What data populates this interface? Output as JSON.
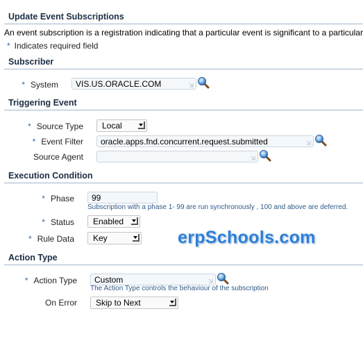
{
  "page": {
    "title": "Update Event Subscriptions",
    "description": "An event subscription is a registration indicating that a particular event is significant to a particular",
    "required_marker": "*",
    "required_note": "Indicates required field"
  },
  "subscriber": {
    "header": "Subscriber",
    "system": {
      "label": "System",
      "value": "VIS.US.ORACLE.COM",
      "icon": "search-icon"
    }
  },
  "triggering_event": {
    "header": "Triggering Event",
    "source_type": {
      "label": "Source Type",
      "value": "Local"
    },
    "event_filter": {
      "label": "Event Filter",
      "value": "oracle.apps.fnd.concurrent.request.submitted",
      "icon": "search-icon"
    },
    "source_agent": {
      "label": "Source Agent",
      "value": "",
      "icon": "search-icon"
    }
  },
  "execution_condition": {
    "header": "Execution Condition",
    "phase": {
      "label": "Phase",
      "value": "99",
      "hint": "Subscription with a phase 1- 99 are run synchronously , 100 and above are deferred."
    },
    "status": {
      "label": "Status",
      "value": "Enabled"
    },
    "rule_data": {
      "label": "Rule Data",
      "value": "Key"
    }
  },
  "action_type": {
    "header": "Action Type",
    "action_type": {
      "label": "Action Type",
      "value": "Custom",
      "hint": "The Action Type controls the behaviour of the subscription",
      "icon": "search-icon"
    },
    "on_error": {
      "label": "On Error",
      "value": "Skip to Next"
    }
  },
  "watermark": "erpSchools.com",
  "colors": {
    "header_text": "#1c2e45",
    "header_rule": "#9fb6cd",
    "hint_text": "#2f5a88",
    "watermark": "#2b7fd9"
  }
}
